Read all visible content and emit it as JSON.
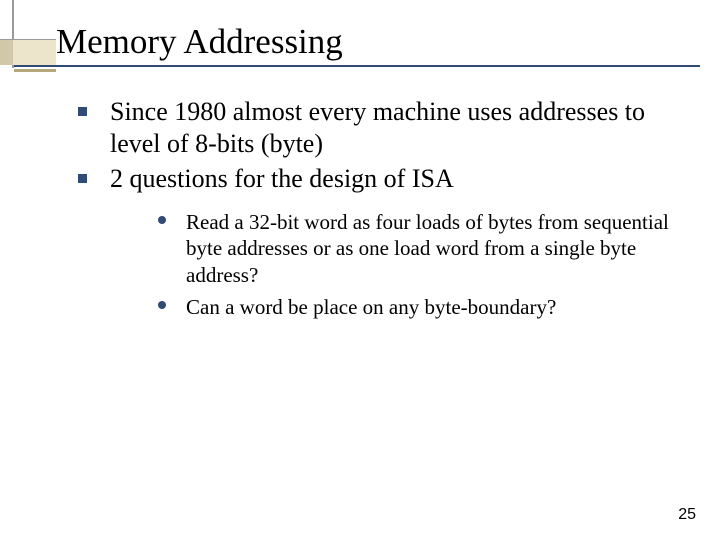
{
  "title": "Memory Addressing",
  "bullets": {
    "level1": [
      "Since 1980 almost every machine uses addresses to level of 8-bits (byte)",
      "2 questions for the design of ISA"
    ],
    "level2": [
      "Read a 32-bit word as four loads of bytes from sequential byte addresses or as one load word from a single byte address?",
      "Can a word be place on any byte-boundary?"
    ]
  },
  "page_number": "25",
  "colors": {
    "accent_blue": "#314b77",
    "accent_tan": "#b4a87a",
    "corner_gray": "#9a9a9a"
  }
}
